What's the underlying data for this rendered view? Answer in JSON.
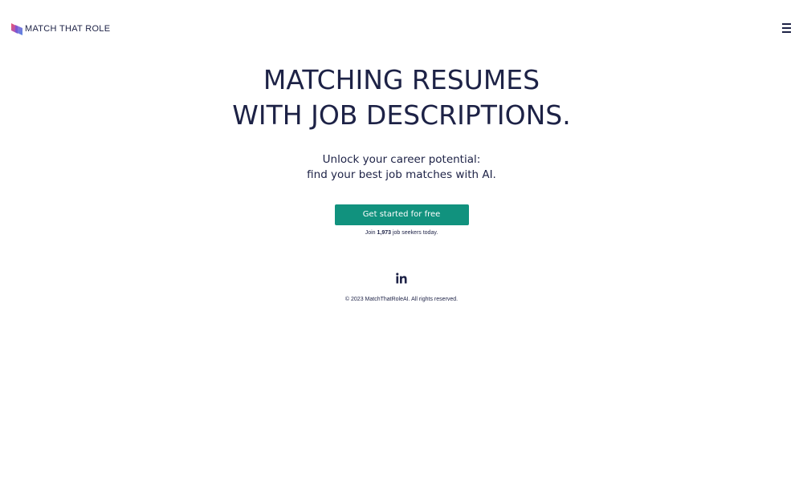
{
  "header": {
    "logo_text": "MATCH THAT ROLE",
    "logo_icon": "match-that-role-logo",
    "menu_icon": "hamburger-menu-icon"
  },
  "hero": {
    "headline_line1": "MATCHING RESUMES",
    "headline_line2": "WITH JOB DESCRIPTIONS.",
    "subhead_line1": "Unlock your career potential:",
    "subhead_line2": "find your best job matches with AI.",
    "cta_label": "Get started for free",
    "social_proof_prefix": "Join ",
    "social_proof_count": "1,973",
    "social_proof_suffix": " job seekers today."
  },
  "footer": {
    "social_icon": "linkedin-icon",
    "copyright": "© 2023 MatchThatRoleAI. All rights reserved."
  },
  "colors": {
    "text": "#1d2246",
    "cta_background": "#11927e",
    "cta_text": "#ffffff",
    "background": "#ffffff",
    "logo_gradient_start": "#e84a6a",
    "logo_gradient_end": "#3b6fd9"
  }
}
